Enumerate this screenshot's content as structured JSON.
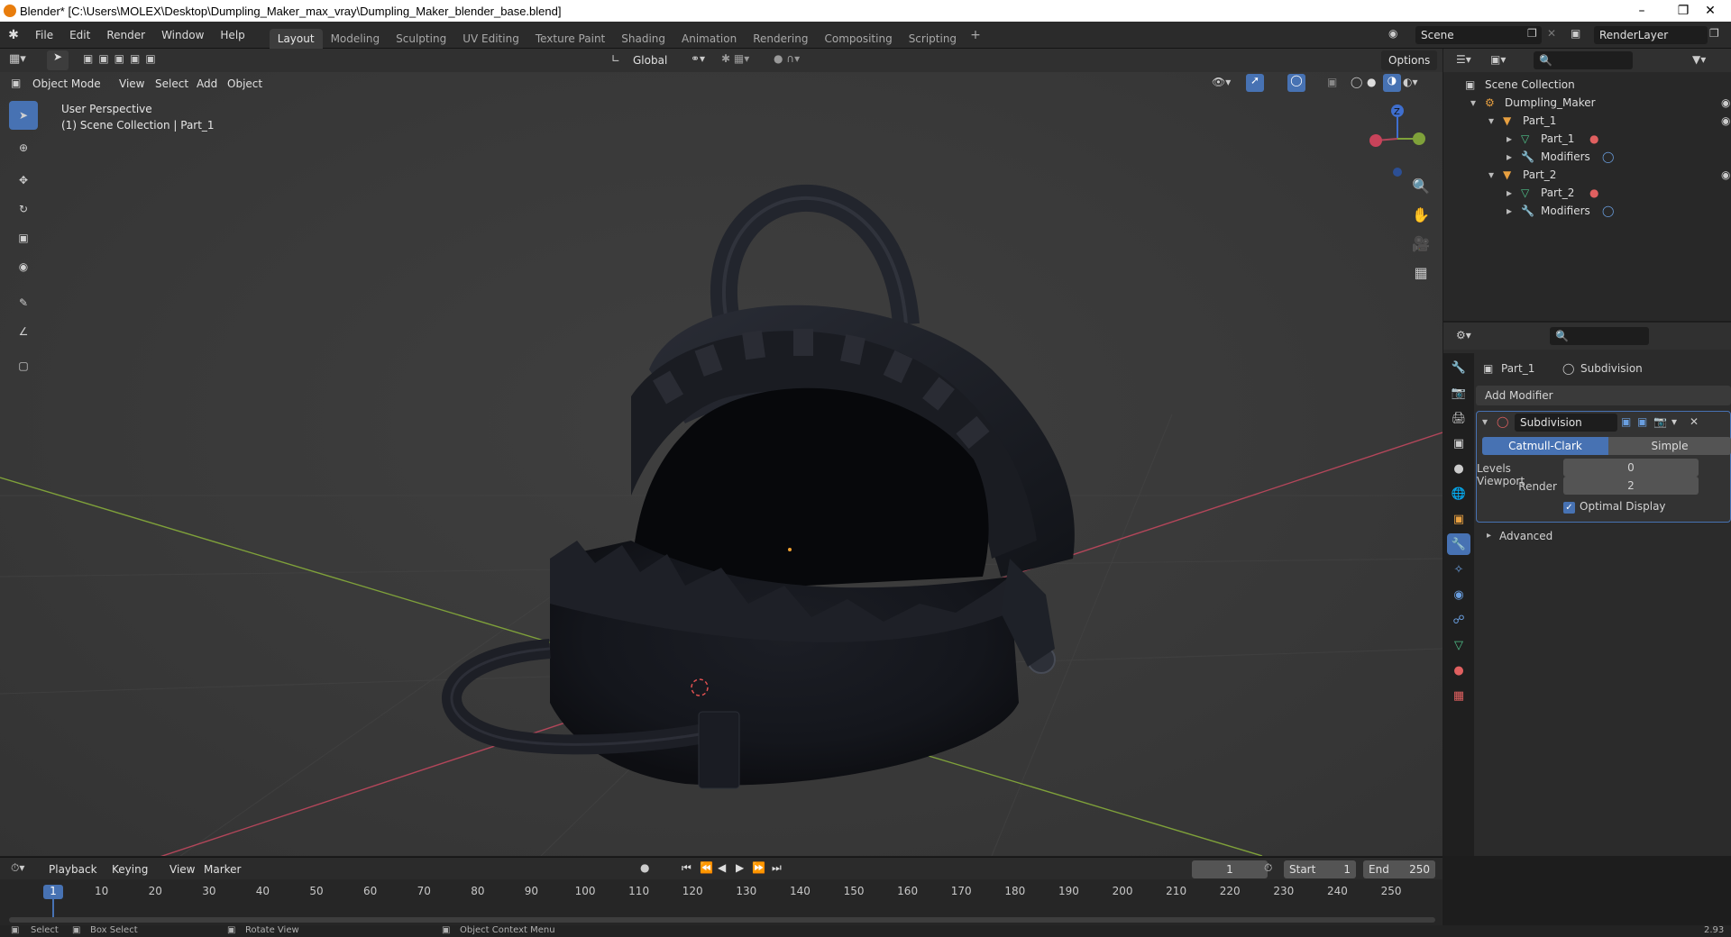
{
  "window": {
    "title": "Blender* [C:\\Users\\MOLEX\\Desktop\\Dumpling_Maker_max_vray\\Dumpling_Maker_blender_base.blend]"
  },
  "menu": [
    "File",
    "Edit",
    "Render",
    "Window",
    "Help"
  ],
  "workspaces": [
    "Layout",
    "Modeling",
    "Sculpting",
    "UV Editing",
    "Texture Paint",
    "Shading",
    "Animation",
    "Rendering",
    "Compositing",
    "Scripting"
  ],
  "scene": {
    "name": "Scene",
    "view_layer": "RenderLayer"
  },
  "toolbar": {
    "transform_orientation": "Global",
    "options": "Options"
  },
  "viewport": {
    "mode": "Object Mode",
    "menus": [
      "View",
      "Select",
      "Add",
      "Object"
    ],
    "overlay_line1": "User Perspective",
    "overlay_line2": "(1) Scene Collection | Part_1",
    "gizmo_z": "Z"
  },
  "outliner": {
    "root": "Scene Collection",
    "rows": [
      {
        "label": "Dumpling_Maker"
      },
      {
        "label": "Part_1"
      },
      {
        "label": "Part_1"
      },
      {
        "label": "Modifiers"
      },
      {
        "label": "Part_2"
      },
      {
        "label": "Part_2"
      },
      {
        "label": "Modifiers"
      }
    ]
  },
  "properties": {
    "object": "Part_1",
    "modifier_crumb": "Subdivision",
    "add_modifier": "Add Modifier",
    "modifier_name": "Subdivision",
    "algo_catmull": "Catmull-Clark",
    "algo_simple": "Simple",
    "levels_viewport_label": "Levels Viewport",
    "levels_viewport_value": "0",
    "render_label": "Render",
    "render_value": "2",
    "optimal_display": "Optimal Display",
    "advanced": "Advanced"
  },
  "timeline": {
    "menus": [
      "Playback",
      "Keying",
      "View",
      "Marker"
    ],
    "current_frame": "1",
    "start_label": "Start",
    "start": "1",
    "end_label": "End",
    "end": "250",
    "ruler": [
      "1",
      "10",
      "20",
      "30",
      "40",
      "50",
      "60",
      "70",
      "80",
      "90",
      "100",
      "110",
      "120",
      "130",
      "140",
      "150",
      "160",
      "170",
      "180",
      "190",
      "200",
      "210",
      "220",
      "230",
      "240",
      "250"
    ]
  },
  "status": {
    "select": "Select",
    "box_select": "Box Select",
    "rotate_view": "Rotate View",
    "context_menu": "Object Context Menu",
    "version": "2.93"
  },
  "colors": {
    "accent": "#4772b3",
    "header": "#2b2b2b",
    "viewport_bg": "#3a3a3a",
    "x_axis": "#b3465a",
    "y_axis": "#7fa13a"
  }
}
